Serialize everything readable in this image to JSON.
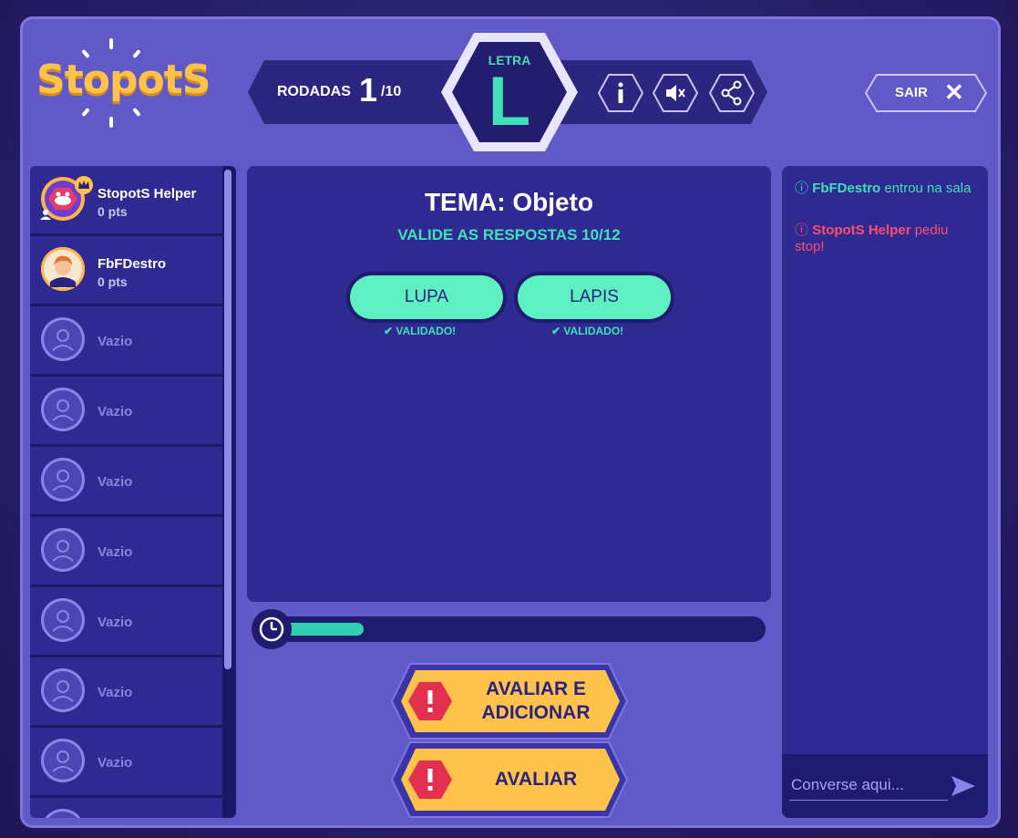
{
  "logo": {
    "text": "StopotS"
  },
  "header": {
    "rounds_label": "RODADAS",
    "round_current": "1",
    "round_total": "/10",
    "letter_label": "LETRA",
    "letter": "L",
    "exit_label": "SAIR"
  },
  "icons": {
    "info": "info-icon",
    "mute": "speaker-mute-icon",
    "share": "share-icon",
    "close": "close-icon",
    "clock": "clock-icon",
    "send": "send-icon",
    "alert": "alert-icon"
  },
  "players": [
    {
      "name": "StopotS Helper",
      "points": "0 pts",
      "empty": false
    },
    {
      "name": "FbFDestro",
      "points": "0 pts",
      "empty": false
    },
    {
      "name": "Vazio",
      "empty": true
    },
    {
      "name": "Vazio",
      "empty": true
    },
    {
      "name": "Vazio",
      "empty": true
    },
    {
      "name": "Vazio",
      "empty": true
    },
    {
      "name": "Vazio",
      "empty": true
    },
    {
      "name": "Vazio",
      "empty": true
    },
    {
      "name": "Vazio",
      "empty": true
    }
  ],
  "main": {
    "theme": "TEMA: Objeto",
    "subtitle": "VALIDE AS RESPOSTAS 10/12",
    "answers": [
      {
        "text": "LUPA",
        "status": "VALIDADO!"
      },
      {
        "text": "LAPIS",
        "status": "VALIDADO!"
      }
    ],
    "timer_progress": 0.18
  },
  "actions": {
    "evaluate_add": "AVALIAR E ADICIONAR",
    "evaluate": "AVALIAR"
  },
  "chat": {
    "messages": [
      {
        "user": "FbFDestro",
        "text": " entrou na sala",
        "color": "#40e0b8"
      },
      {
        "user": "StopotS Helper",
        "text": " pediu stop!",
        "color": "#ff4d6d"
      }
    ],
    "placeholder": "Converse aqui..."
  },
  "colors": {
    "accent": "#40e0b8",
    "alert": "#ff4d6d",
    "button": "#ffc24a",
    "panel": "#2e2a91",
    "frame": "#6059c7"
  }
}
